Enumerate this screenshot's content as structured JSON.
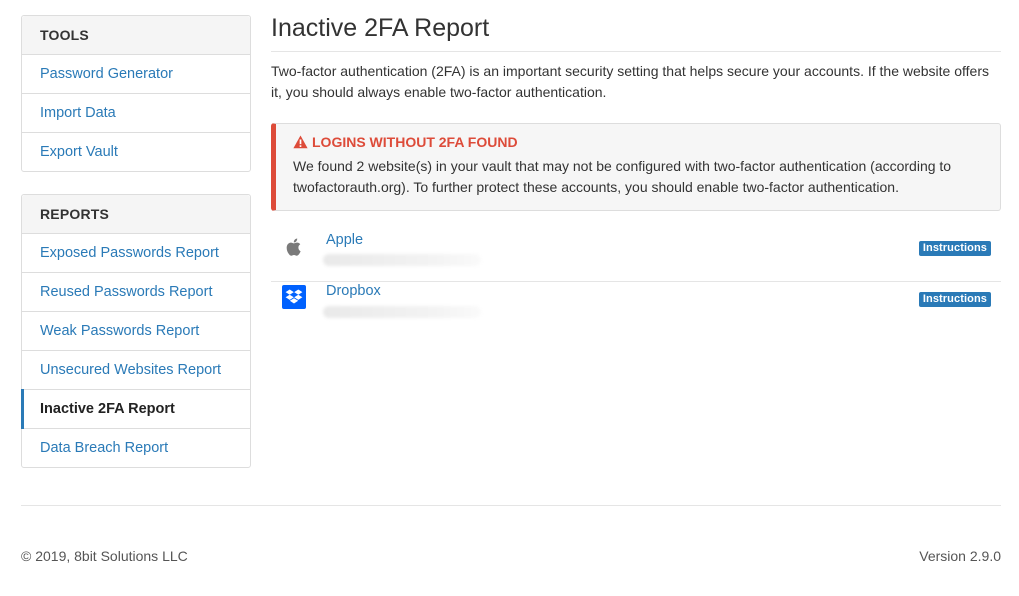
{
  "sidebar": {
    "tools": {
      "heading": "TOOLS",
      "items": [
        {
          "label": "Password Generator"
        },
        {
          "label": "Import Data"
        },
        {
          "label": "Export Vault"
        }
      ]
    },
    "reports": {
      "heading": "REPORTS",
      "items": [
        {
          "label": "Exposed Passwords Report"
        },
        {
          "label": "Reused Passwords Report"
        },
        {
          "label": "Weak Passwords Report"
        },
        {
          "label": "Unsecured Websites Report"
        },
        {
          "label": "Inactive 2FA Report",
          "active": true
        },
        {
          "label": "Data Breach Report"
        }
      ]
    }
  },
  "main": {
    "title": "Inactive 2FA Report",
    "intro": "Two-factor authentication (2FA) is an important security setting that helps secure your accounts. If the website offers it, you should always enable two-factor authentication.",
    "callout": {
      "title": "LOGINS WITHOUT 2FA FOUND",
      "body": "We found 2 website(s) in your vault that may not be configured with two-factor authentication (according to twofactorauth.org). To further protect these accounts, you should enable two-factor authentication.",
      "color": "#dd4b39",
      "icon": "warning-icon"
    },
    "items": [
      {
        "name": "Apple",
        "icon": "apple-icon",
        "badge": "Instructions"
      },
      {
        "name": "Dropbox",
        "icon": "dropbox-icon",
        "badge": "Instructions"
      }
    ]
  },
  "footer": {
    "copyright": "© 2019, 8bit Solutions LLC",
    "version": "Version 2.9.0"
  },
  "colors": {
    "link": "#2a7ab7",
    "danger": "#dd4b39",
    "dropbox": "#0061fe"
  }
}
